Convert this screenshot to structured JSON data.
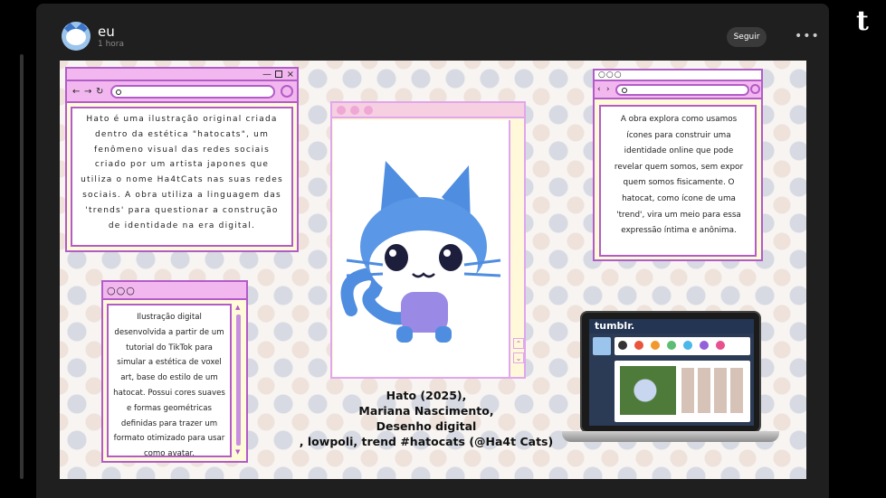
{
  "post": {
    "username": "eu",
    "time": "1 hora",
    "follow_label": "Seguir",
    "more_label": "•••"
  },
  "app": {
    "logo": "t"
  },
  "artwork": {
    "box_top_left_text": "Hato é uma ilustração original criada dentro da estética \"hatocats\", um fenômeno visual das redes sociais criado por um artista japones que utiliza o nome Ha4tCats nas suas redes sociais. A obra utiliza a linguagem das 'trends' para questionar a construção de identidade na era digital.",
    "box_bottom_left_text": "Ilustração digital desenvolvida a partir de um tutorial do TikTok para simular a estética de voxel art, base do estilo de um hatocat. Possui cores suaves e formas geométricas definidas para trazer um formato otimizado para usar como avatar.",
    "box_right_text": "A obra explora como usamos ícones para construir uma identidade online que pode revelar quem somos, sem expor quem somos fisicamente. O hatocat, como ícone de uma 'trend', vira um meio para essa expressão íntima e anônima.",
    "caption_lines": [
      "Hato (2025),",
      "Mariana Nascimento,",
      "Desenho digital",
      ", lowpoli, trend #hatocats (@Ha4t Cats)"
    ],
    "laptop_logo": "tumblr."
  },
  "colors": {
    "window_border": "#b25cc7",
    "window_titlebar": "#f3b7ef",
    "window_body": "#fffbd9",
    "cat_blue": "#4f8de0",
    "cat_purple": "#9a8ae6"
  },
  "icons": {
    "back": "←",
    "forward": "→",
    "refresh": "↻",
    "close": "×",
    "window_dots": "○○○"
  }
}
